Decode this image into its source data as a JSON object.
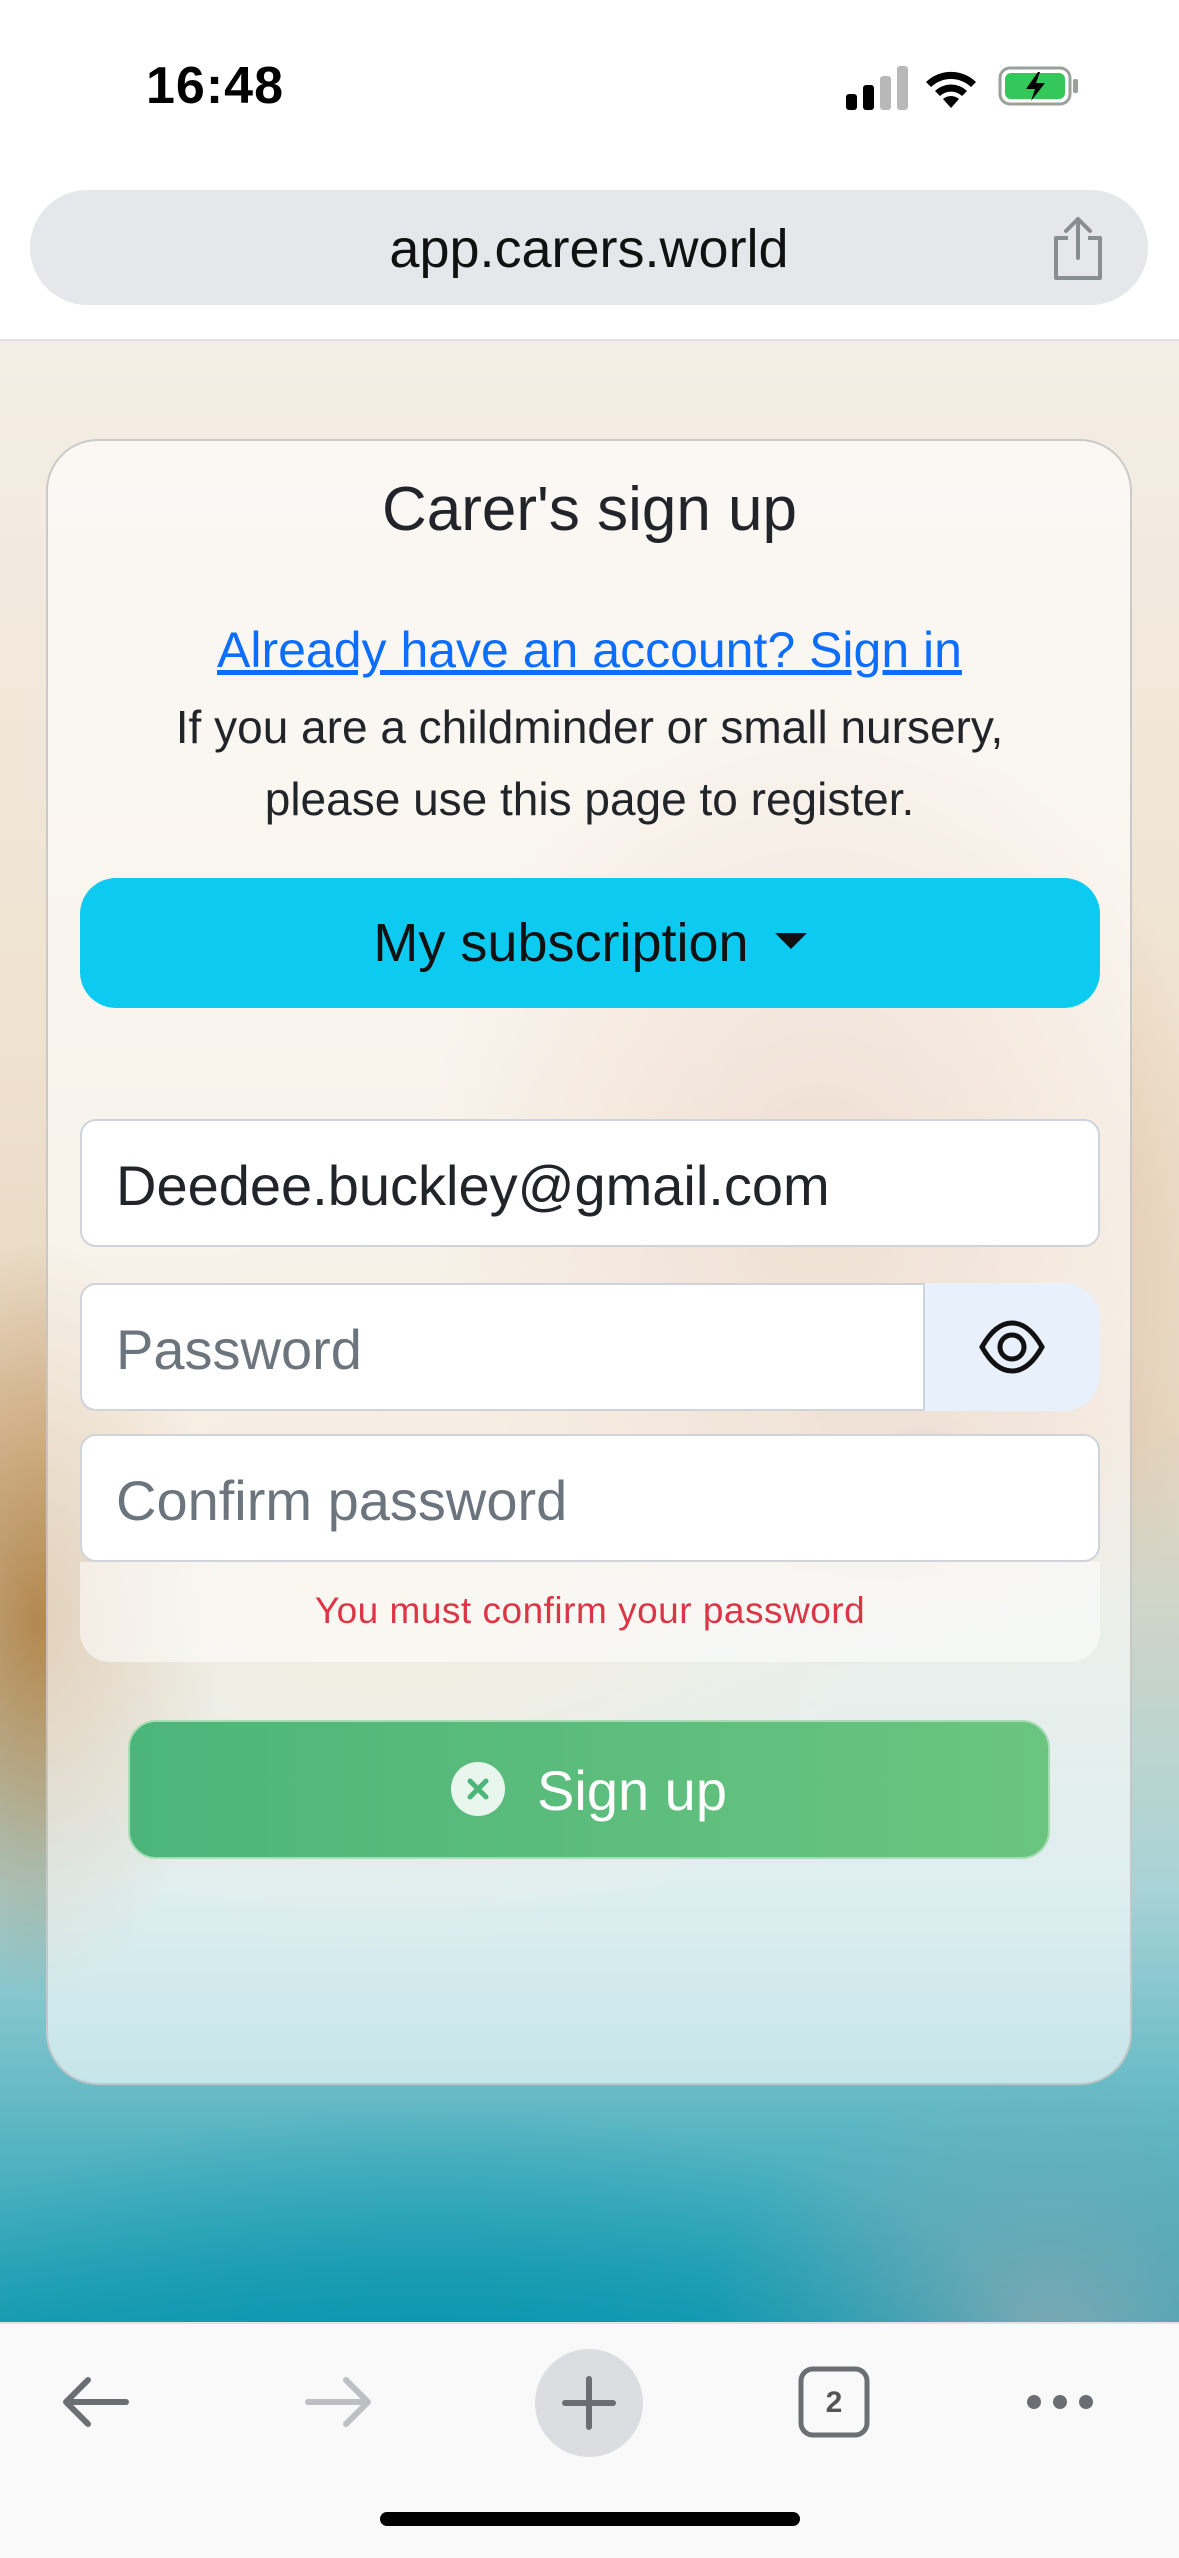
{
  "status_bar": {
    "time": "16:48",
    "signal_icon": "cellular-signal-icon",
    "wifi_icon": "wifi-icon",
    "battery_icon": "battery-charging-icon"
  },
  "browser": {
    "url": "app.carers.world",
    "share_icon": "share-icon",
    "toolbar": {
      "back_icon": "arrow-left-icon",
      "forward_icon": "arrow-right-icon",
      "new_tab_icon": "plus-icon",
      "tab_count": "2",
      "more_icon": "more-dots-icon"
    }
  },
  "form": {
    "title": "Carer's sign up",
    "signin_link": "Already have an account? Sign in",
    "intro_line1": "If you are a childminder or small nursery,",
    "intro_line2": "please use this page to register.",
    "subscription_label": "My subscription",
    "email_value": "Deedee.buckley@gmail.com",
    "password_placeholder": "Password",
    "confirm_placeholder": "Confirm password",
    "error_message": "You must confirm your password",
    "signup_label": "Sign up"
  },
  "colors": {
    "subscription_bg": "#0dcaf0",
    "signup_bg": "#5cbf7d",
    "error_text": "#dc3545",
    "link": "#0d6efd"
  }
}
